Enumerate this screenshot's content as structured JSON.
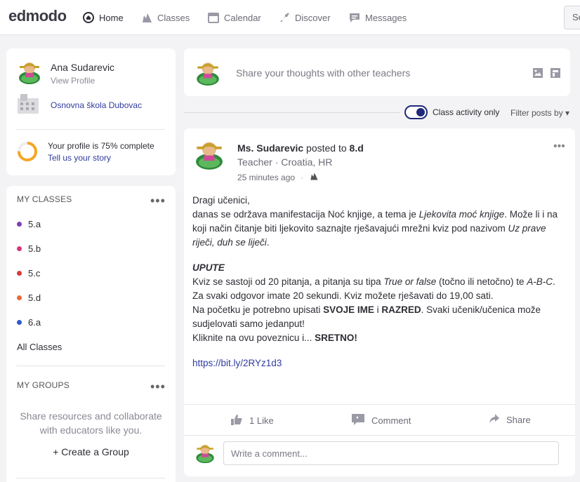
{
  "header": {
    "logo": "edmodo",
    "nav": [
      {
        "label": "Home",
        "icon": "home-icon"
      },
      {
        "label": "Classes",
        "icon": "classes-icon"
      },
      {
        "label": "Calendar",
        "icon": "calendar-icon"
      },
      {
        "label": "Discover",
        "icon": "rocket-icon"
      },
      {
        "label": "Messages",
        "icon": "chat-icon"
      }
    ],
    "search_placeholder": "Se"
  },
  "profile": {
    "name": "Ana Sudarevic",
    "view_profile": "View Profile",
    "school": "Osnovna škola Dubovac",
    "completion_text": "Your profile is 75% complete",
    "completion_percent": 75,
    "tell_story": "Tell us your story"
  },
  "classes": {
    "title": "MY CLASSES",
    "items": [
      {
        "label": "5.a",
        "color": "#7e3fb5"
      },
      {
        "label": "5.b",
        "color": "#d8357a"
      },
      {
        "label": "5.c",
        "color": "#d93a3a"
      },
      {
        "label": "5.d",
        "color": "#e86a3c"
      },
      {
        "label": "6.a",
        "color": "#2f5bc9"
      }
    ],
    "all_classes": "All Classes"
  },
  "groups": {
    "title": "MY GROUPS",
    "description_line1": "Share resources and collaborate",
    "description_line2": "with educators like you.",
    "create_label": "+ Create a Group"
  },
  "share": {
    "placeholder": "Share your thoughts with other teachers"
  },
  "filter": {
    "toggle_label": "Class activity only",
    "toggle_on": true,
    "filter_label": "Filter posts by ▾"
  },
  "post": {
    "author": "Ms. Sudarevic",
    "posted_to_text": "posted to",
    "posted_to": "8.d",
    "role": "Teacher · Croatia, HR",
    "time": "25 minutes ago",
    "body": {
      "greeting": "Dragi učenici,",
      "p1_a": "danas se održava manifestacija Noć knjige, a tema je ",
      "p1_em": "Ljekovita moć knjige",
      "p1_b": ". Može li i na koji način čitanje biti ljekovito saznajte rješavajući mrežni kviz pod nazivom ",
      "p1_em2": "Uz prave riječi, duh se liječi",
      "p1_c": ".",
      "heading": "UPUTE",
      "p2_a": "Kviz se sastoji od 20 pitanja, a pitanja su tipa ",
      "p2_em": "True or false",
      "p2_b": " (točno ili netočno) te ",
      "p2_em2": "A-B-C",
      "p2_c": ".",
      "p3": "Za svaki odgovor imate 20 sekundi. Kviz možete rješavati do 19,00 sati.",
      "p4_a": "Na početku je potrebno upisati ",
      "p4_b1": "SVOJE IME",
      "p4_mid": " i ",
      "p4_b2": "RAZRED",
      "p4_c": ". Svaki učenik/učenica može sudjelovati samo jedanput!",
      "p5_a": "Kliknite na ovu poveznicu i... ",
      "p5_b": "SRETNO!",
      "link": "https://bit.ly/2RYz1d3"
    },
    "likes": "1 Like",
    "comment": "Comment",
    "share": "Share",
    "comment_placeholder": "Write a comment..."
  }
}
